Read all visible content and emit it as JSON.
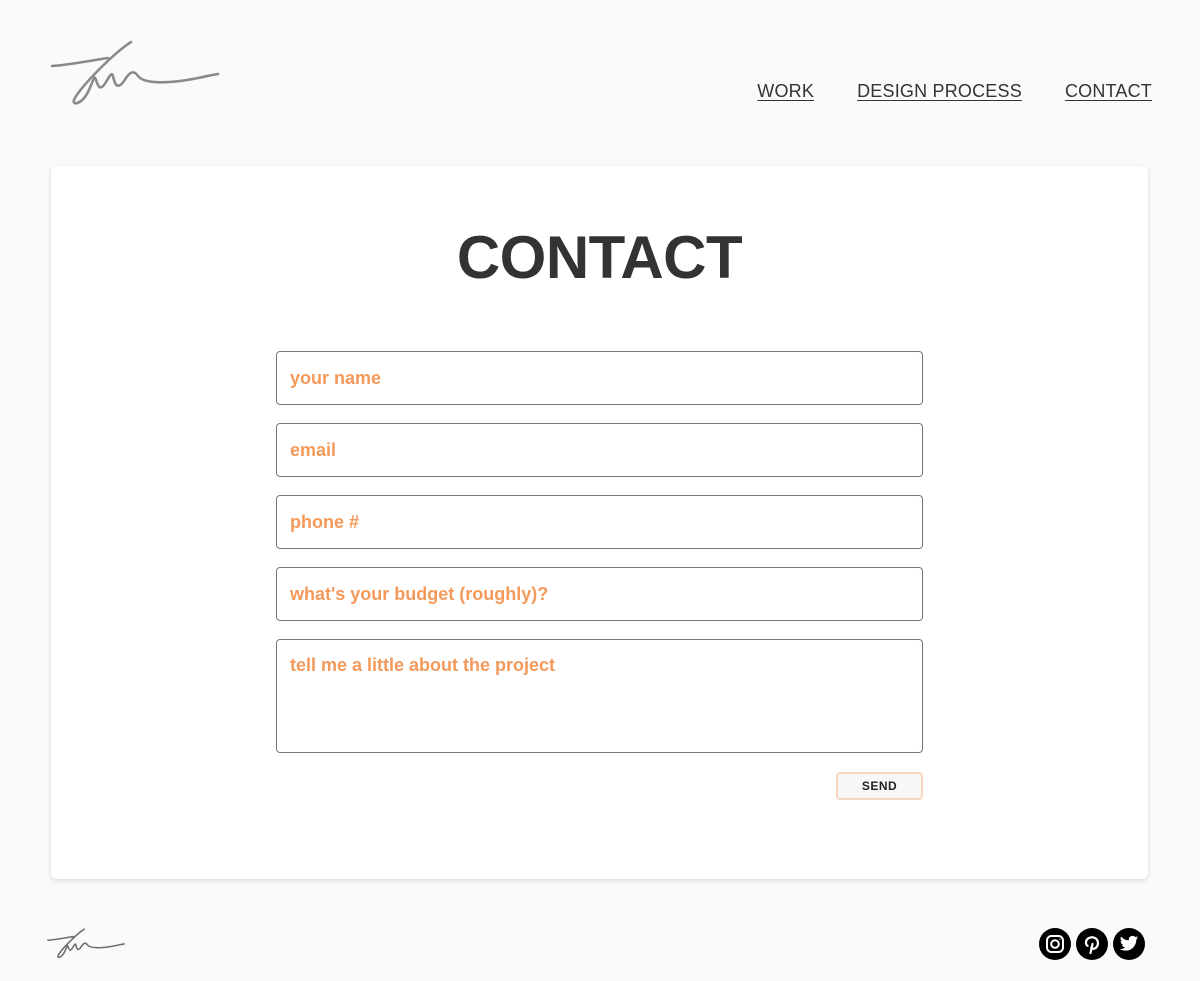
{
  "header": {
    "logo_icon": "signature-logo",
    "nav": [
      {
        "label": "WORK"
      },
      {
        "label": "DESIGN PROCESS"
      },
      {
        "label": "CONTACT"
      }
    ]
  },
  "contact": {
    "title": "CONTACT",
    "fields": {
      "name": {
        "placeholder": "your name",
        "value": ""
      },
      "email": {
        "placeholder": "email",
        "value": ""
      },
      "phone": {
        "placeholder": "phone #",
        "value": ""
      },
      "budget": {
        "placeholder": "what's your budget (roughly)?",
        "value": ""
      },
      "project": {
        "placeholder": "tell me a little about the project",
        "value": ""
      }
    },
    "send_label": "SEND"
  },
  "footer": {
    "logo_icon": "signature-logo",
    "social": [
      {
        "icon": "instagram-icon"
      },
      {
        "icon": "pinterest-icon"
      },
      {
        "icon": "twitter-icon"
      }
    ]
  },
  "colors": {
    "placeholder": "#f39a5b",
    "title": "#333333",
    "background": "#fafafa",
    "card": "#ffffff",
    "send_border": "#f7d7c1"
  }
}
